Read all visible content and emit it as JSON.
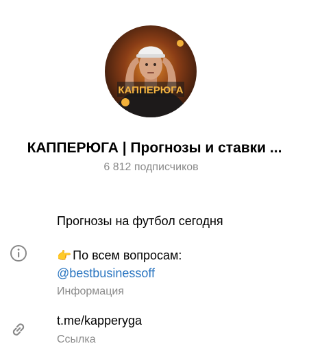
{
  "channel": {
    "title": "КАППЕРЮГА | Прогнозы и ставки ...",
    "subscribers": "6 812 подписчиков",
    "avatar_text": "КАППЕРЮГА"
  },
  "info": {
    "description": "Прогнозы на футбол сегодня",
    "contact_emoji": "👉",
    "contact_text": "По всем вопросам:",
    "contact_handle": "@bestbusinessoff",
    "caption": "Информация",
    "icon": "info-icon"
  },
  "link": {
    "value": "t.me/kapperyga",
    "caption": "Ссылка",
    "icon": "link-icon"
  },
  "colors": {
    "link": "#2b76c1",
    "secondary_text": "#8a8a8a",
    "icon": "#888888"
  }
}
